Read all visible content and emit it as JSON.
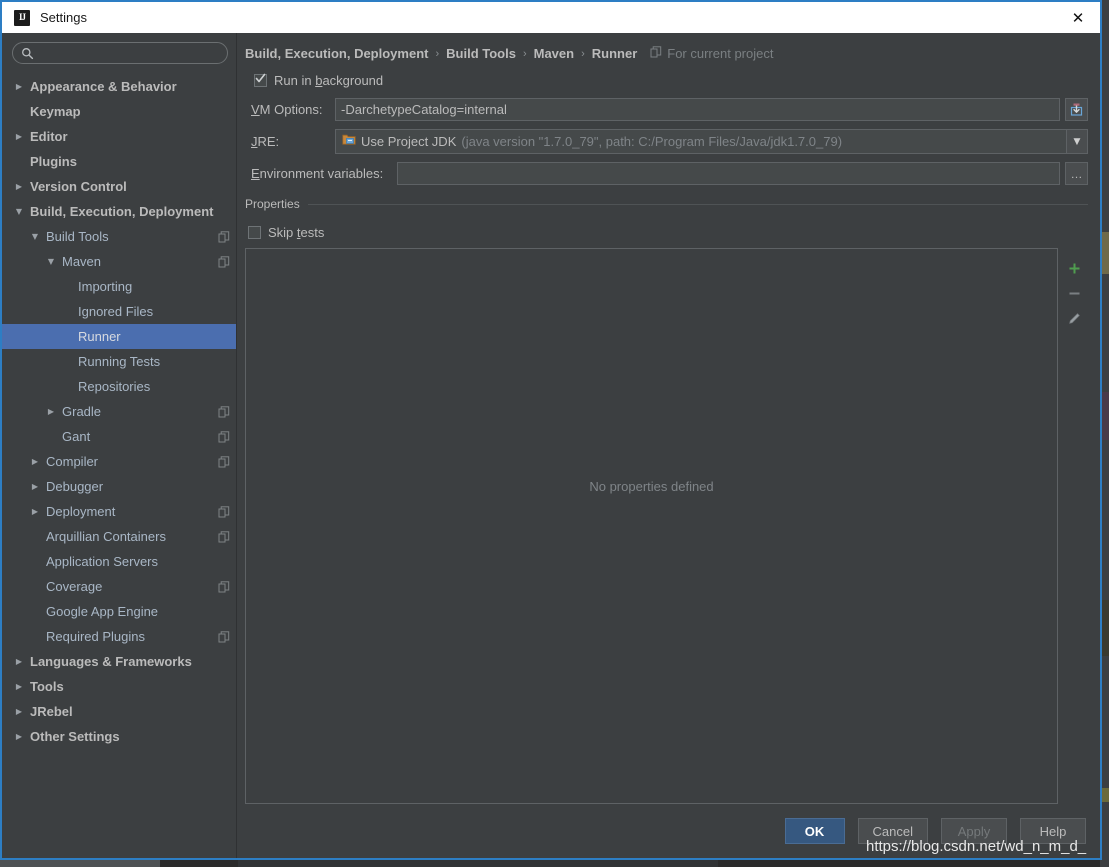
{
  "window": {
    "title": "Settings",
    "app_icon": "intellij-idea-icon",
    "close_label": "✕"
  },
  "sidebar": {
    "search": {
      "value": "",
      "placeholder": "",
      "icon": "search-icon"
    },
    "items": [
      {
        "label": "Appearance & Behavior",
        "indent": 0,
        "arrow": "collapsed",
        "bold": true,
        "badge": false,
        "selected": false
      },
      {
        "label": "Keymap",
        "indent": 0,
        "arrow": "none",
        "bold": true,
        "badge": false,
        "selected": false
      },
      {
        "label": "Editor",
        "indent": 0,
        "arrow": "collapsed",
        "bold": true,
        "badge": false,
        "selected": false
      },
      {
        "label": "Plugins",
        "indent": 0,
        "arrow": "none",
        "bold": true,
        "badge": false,
        "selected": false
      },
      {
        "label": "Version Control",
        "indent": 0,
        "arrow": "collapsed",
        "bold": true,
        "badge": false,
        "selected": false
      },
      {
        "label": "Build, Execution, Deployment",
        "indent": 0,
        "arrow": "expanded",
        "bold": true,
        "badge": false,
        "selected": false
      },
      {
        "label": "Build Tools",
        "indent": 1,
        "arrow": "expanded",
        "bold": false,
        "badge": true,
        "selected": false
      },
      {
        "label": "Maven",
        "indent": 2,
        "arrow": "expanded",
        "bold": false,
        "badge": true,
        "selected": false
      },
      {
        "label": "Importing",
        "indent": 3,
        "arrow": "none",
        "bold": false,
        "badge": false,
        "selected": false
      },
      {
        "label": "Ignored Files",
        "indent": 3,
        "arrow": "none",
        "bold": false,
        "badge": false,
        "selected": false
      },
      {
        "label": "Runner",
        "indent": 3,
        "arrow": "none",
        "bold": false,
        "badge": false,
        "selected": true
      },
      {
        "label": "Running Tests",
        "indent": 3,
        "arrow": "none",
        "bold": false,
        "badge": false,
        "selected": false
      },
      {
        "label": "Repositories",
        "indent": 3,
        "arrow": "none",
        "bold": false,
        "badge": false,
        "selected": false
      },
      {
        "label": "Gradle",
        "indent": 2,
        "arrow": "collapsed",
        "bold": false,
        "badge": true,
        "selected": false
      },
      {
        "label": "Gant",
        "indent": 2,
        "arrow": "none",
        "bold": false,
        "badge": true,
        "selected": false
      },
      {
        "label": "Compiler",
        "indent": 1,
        "arrow": "collapsed",
        "bold": false,
        "badge": true,
        "selected": false
      },
      {
        "label": "Debugger",
        "indent": 1,
        "arrow": "collapsed",
        "bold": false,
        "badge": false,
        "selected": false
      },
      {
        "label": "Deployment",
        "indent": 1,
        "arrow": "collapsed",
        "bold": false,
        "badge": true,
        "selected": false
      },
      {
        "label": "Arquillian Containers",
        "indent": 1,
        "arrow": "none",
        "bold": false,
        "badge": true,
        "selected": false
      },
      {
        "label": "Application Servers",
        "indent": 1,
        "arrow": "none",
        "bold": false,
        "badge": false,
        "selected": false
      },
      {
        "label": "Coverage",
        "indent": 1,
        "arrow": "none",
        "bold": false,
        "badge": true,
        "selected": false
      },
      {
        "label": "Google App Engine",
        "indent": 1,
        "arrow": "none",
        "bold": false,
        "badge": false,
        "selected": false
      },
      {
        "label": "Required Plugins",
        "indent": 1,
        "arrow": "none",
        "bold": false,
        "badge": true,
        "selected": false
      },
      {
        "label": "Languages & Frameworks",
        "indent": 0,
        "arrow": "collapsed",
        "bold": true,
        "badge": false,
        "selected": false
      },
      {
        "label": "Tools",
        "indent": 0,
        "arrow": "collapsed",
        "bold": true,
        "badge": false,
        "selected": false
      },
      {
        "label": "JRebel",
        "indent": 0,
        "arrow": "collapsed",
        "bold": true,
        "badge": false,
        "selected": false
      },
      {
        "label": "Other Settings",
        "indent": 0,
        "arrow": "collapsed",
        "bold": true,
        "badge": false,
        "selected": false
      }
    ]
  },
  "breadcrumb": {
    "crumbs": [
      "Build, Execution, Deployment",
      "Build Tools",
      "Maven",
      "Runner"
    ],
    "separator": "›",
    "scope_label": "For current project",
    "scope_icon": "project-scope-icon"
  },
  "main": {
    "run_in_background": {
      "label_pre": "Run in ",
      "label_mnemonic": "b",
      "label_post": "ackground",
      "checked": true
    },
    "vm_options": {
      "label_mnemonic": "V",
      "label_rest": "M Options:",
      "value": "-DarchetypeCatalog=internal",
      "browse_icon": "insert-macro-icon"
    },
    "jre": {
      "label_mnemonic": "J",
      "label_rest": "RE:",
      "icon": "jdk-folder-icon",
      "value": "Use Project JDK",
      "detail": "(java version \"1.7.0_79\", path: C:/Program Files/Java/jdk1.7.0_79)",
      "dropdown_icon": "chevron-down-icon"
    },
    "environment_variables": {
      "label_mnemonic": "E",
      "label_rest": "nvironment variables:",
      "value": "",
      "browse_label": "…"
    },
    "properties": {
      "group_title": "Properties",
      "skip_tests": {
        "label_pre": "Skip ",
        "label_mnemonic": "t",
        "label_post": "ests",
        "checked": false
      },
      "empty_text": "No properties defined",
      "toolbar": [
        {
          "name": "add-property-button",
          "icon": "plus-icon"
        },
        {
          "name": "remove-property-button",
          "icon": "minus-icon"
        },
        {
          "name": "edit-property-button",
          "icon": "pencil-icon"
        }
      ]
    }
  },
  "footer": {
    "ok": "OK",
    "cancel": "Cancel",
    "apply": "Apply",
    "help": "Help",
    "apply_disabled": true
  },
  "watermark": {
    "text": "https://blog.csdn.net/wd_n_m_d_"
  },
  "colors": {
    "dialog_border": "#2d7ec4",
    "panel_bg": "#3c3f41",
    "field_bg": "#45494a",
    "text": "#bbbbbb",
    "muted_text": "#7f8488",
    "selection": "#4b6eaf",
    "primary_button": "#365880",
    "titlebar_bg": "#ffffff",
    "add_icon": "#4f9d4f"
  }
}
